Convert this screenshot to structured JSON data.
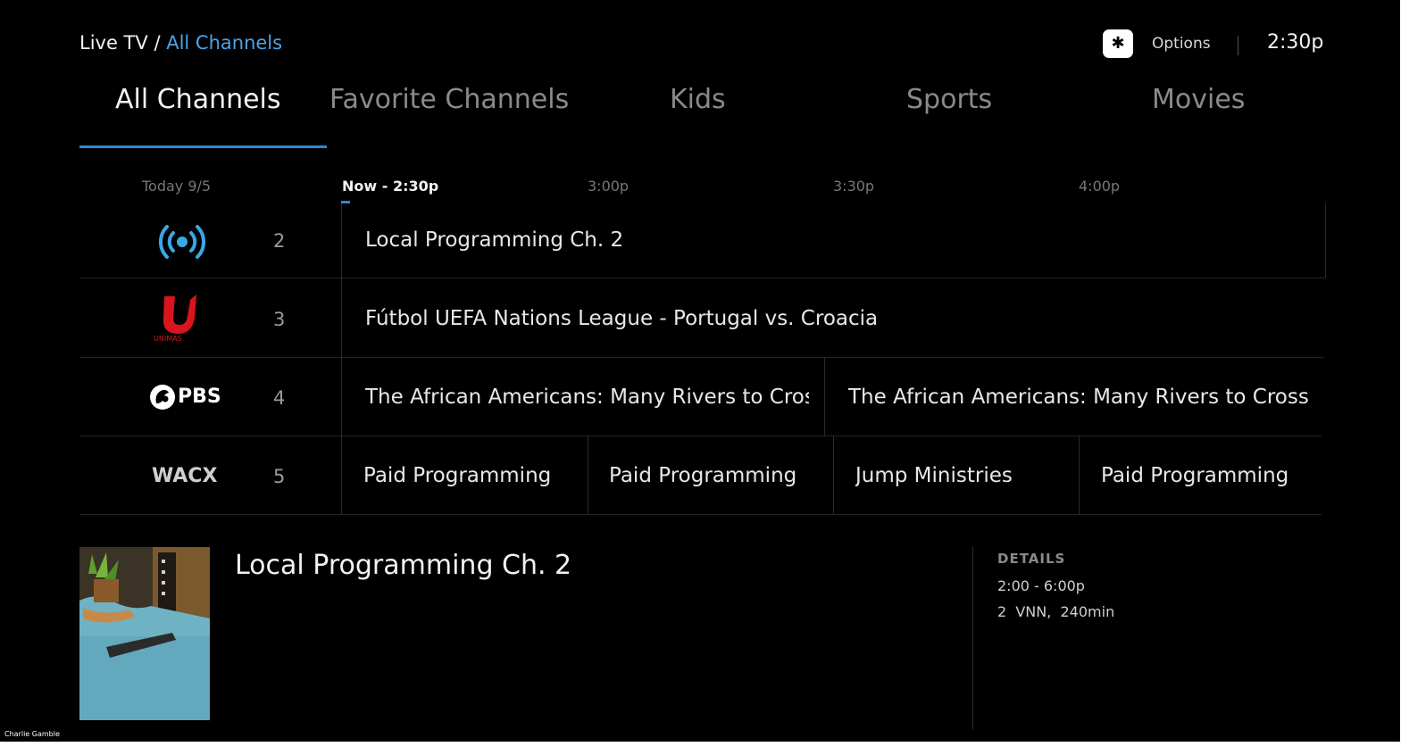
{
  "breadcrumb": {
    "root": "Live TV",
    "separator": "/",
    "current": "All Channels"
  },
  "header": {
    "options_icon": "asterisk-icon",
    "options_glyph": "✱",
    "options_label": "Options",
    "clock": "2:30p"
  },
  "tabs": [
    {
      "label": "All Channels",
      "active": true
    },
    {
      "label": "Favorite Channels",
      "active": false
    },
    {
      "label": "Kids",
      "active": false
    },
    {
      "label": "Sports",
      "active": false
    },
    {
      "label": "Movies",
      "active": false
    }
  ],
  "guide": {
    "date": "Today 9/5",
    "times": [
      "Now - 2:30p",
      "3:00p",
      "3:30p",
      "4:00p"
    ],
    "channels": [
      {
        "logo": "broadcast-signal-icon",
        "number": "2",
        "programs": [
          "Local Programming Ch. 2"
        ]
      },
      {
        "logo": "unimas-logo",
        "logo_text": "UNIMAS",
        "number": "3",
        "programs": [
          "Fútbol UEFA Nations League - Portugal vs. Croacia"
        ]
      },
      {
        "logo": "pbs-logo",
        "logo_text": "PBS",
        "number": "4",
        "programs": [
          "The African Americans: Many Rivers to Cross",
          "The African Americans: Many Rivers to Cross"
        ]
      },
      {
        "logo": "callsign-text",
        "logo_text": "WACX",
        "number": "5",
        "programs": [
          "Paid Programming",
          "Paid Programming",
          "Jump Ministries",
          "Paid Programming"
        ]
      }
    ]
  },
  "details": {
    "title": "Local Programming Ch. 2",
    "heading": "DETAILS",
    "time": "2:00 - 6:00p",
    "info": "2  VNN,  240min"
  },
  "credit": "Charlie Gamble",
  "colors": {
    "accent": "#2f86d8",
    "breadcrumb_current": "#4da3e6",
    "background": "#000000"
  }
}
